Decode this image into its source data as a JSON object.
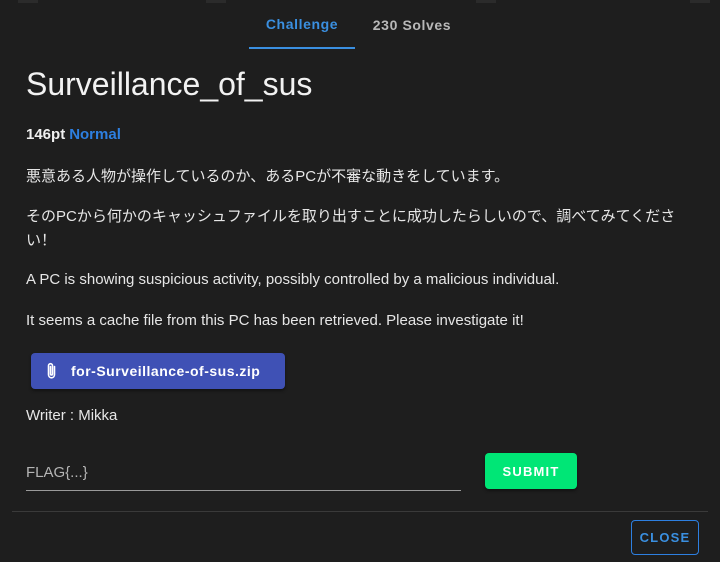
{
  "tabs": [
    {
      "label": "Challenge",
      "active": true
    },
    {
      "label": "230 Solves",
      "active": false
    }
  ],
  "challenge": {
    "title": "Surveillance_of_sus",
    "points": "146pt",
    "difficulty": "Normal",
    "description": [
      "悪意ある人物が操作しているのか、あるPCが不審な動きをしています。",
      "そのPCから何かのキャッシュファイルを取り出すことに成功したらしいので、調べてみてください！",
      "A PC is showing suspicious activity, possibly controlled by a malicious individual.",
      "It seems a cache file from this PC has been retrieved. Please investigate it!"
    ],
    "file": {
      "label": "for-Surveillance-of-sus.zip",
      "icon": "paperclip-icon"
    },
    "writer": "Writer : Mikka"
  },
  "flag_form": {
    "placeholder": "FLAG{...}",
    "value": "",
    "submit_label": "SUBMIT"
  },
  "footer": {
    "close_label": "CLOSE"
  },
  "colors": {
    "accent": "#3a8fe0",
    "file_button": "#3f51b5",
    "submit_button": "#00e676",
    "background": "#1e1e1e"
  }
}
